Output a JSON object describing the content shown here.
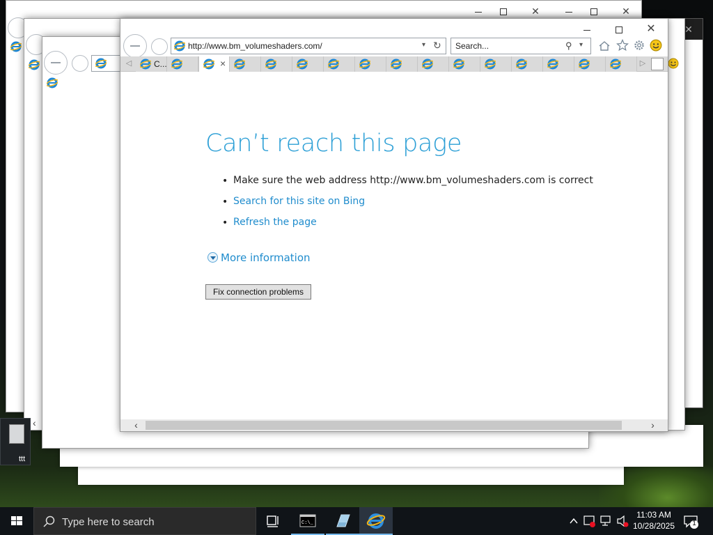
{
  "browser": {
    "address": "http://www.bm_volumeshaders.com/",
    "search_placeholder": "Search...",
    "first_tab_label": "C...",
    "tab_count": 16
  },
  "error_page": {
    "title": "Can’t reach this page",
    "bullet_1": "Make sure the web address http://www.bm_volumeshaders.com is correct",
    "bullet_2": "Search for this site on Bing",
    "bullet_3": "Refresh the page",
    "more_info": "More information",
    "fix_button": "Fix connection problems"
  },
  "desktop": {
    "icon_label": "ttt"
  },
  "taskbar": {
    "search_placeholder": "Type here to search",
    "time": "11:03 AM",
    "date": "10/28/2025",
    "notification_count": "1"
  },
  "colors": {
    "accent_blue": "#2c9fd6",
    "link_blue": "#1f8ccd",
    "taskbar": "#101418"
  },
  "icons": [
    "windows-logo-icon",
    "search-icon",
    "task-view-icon",
    "cmd-icon",
    "app-icon",
    "ie-icon",
    "chevron-up-icon",
    "shield-icon",
    "network-icon",
    "speaker-muted-icon",
    "notification-icon",
    "home-icon",
    "star-icon",
    "gear-icon",
    "smiley-icon",
    "back-icon",
    "forward-icon",
    "refresh-icon",
    "close-icon",
    "maximize-icon",
    "minimize-icon"
  ]
}
